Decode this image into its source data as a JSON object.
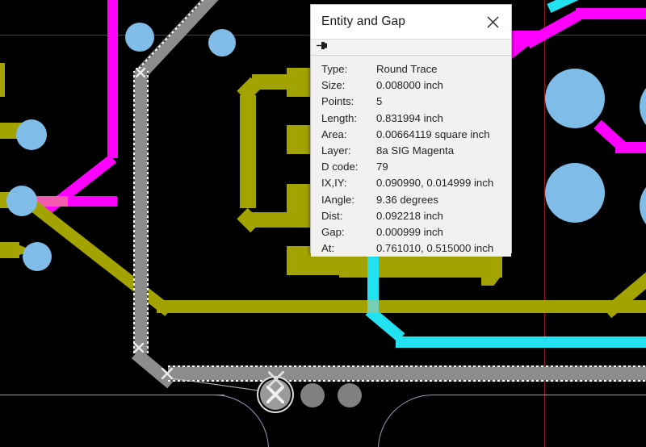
{
  "app": {
    "view": "pcb-cam-canvas",
    "background_color": "#000000"
  },
  "dialog": {
    "title": "Entity and Gap",
    "close_icon": "close-icon",
    "pin_icon": "pushpin-icon",
    "rows": [
      {
        "label": "Type:",
        "value": "Round Trace"
      },
      {
        "label": "Size:",
        "value": "0.008000 inch"
      },
      {
        "label": "Points:",
        "value": "5"
      },
      {
        "label": "Length:",
        "value": "0.831994 inch"
      },
      {
        "label": "Area:",
        "value": "0.00664119 square inch"
      },
      {
        "label": "Layer:",
        "value": "8a SIG Magenta"
      },
      {
        "label": "D code:",
        "value": "79"
      },
      {
        "label": "IX,IY:",
        "value": "0.090990, 0.014999 inch"
      },
      {
        "label": "IAngle:",
        "value": "9.36 degrees"
      },
      {
        "label": "Dist:",
        "value": "0.092218 inch"
      },
      {
        "label": "Gap:",
        "value": "0.000999 inch"
      },
      {
        "label": "At:",
        "value": "0.761010, 0.515000 inch"
      }
    ]
  },
  "colors": {
    "magenta_trace": "#ff00ff",
    "yellow_trace": "#a3a300",
    "cyan_trace": "#22e2f2",
    "selected_trace_gray": "#8c8c8c",
    "via_blue": "#7fbce8",
    "pad_gray": "#808080",
    "guide_red": "#8f1d1d",
    "board_outline": "#9a9ab8",
    "canvas_black": "#000000"
  },
  "layers": {
    "selected_layer_name": "8a SIG Magenta",
    "selected_entity_type": "Round Trace"
  }
}
